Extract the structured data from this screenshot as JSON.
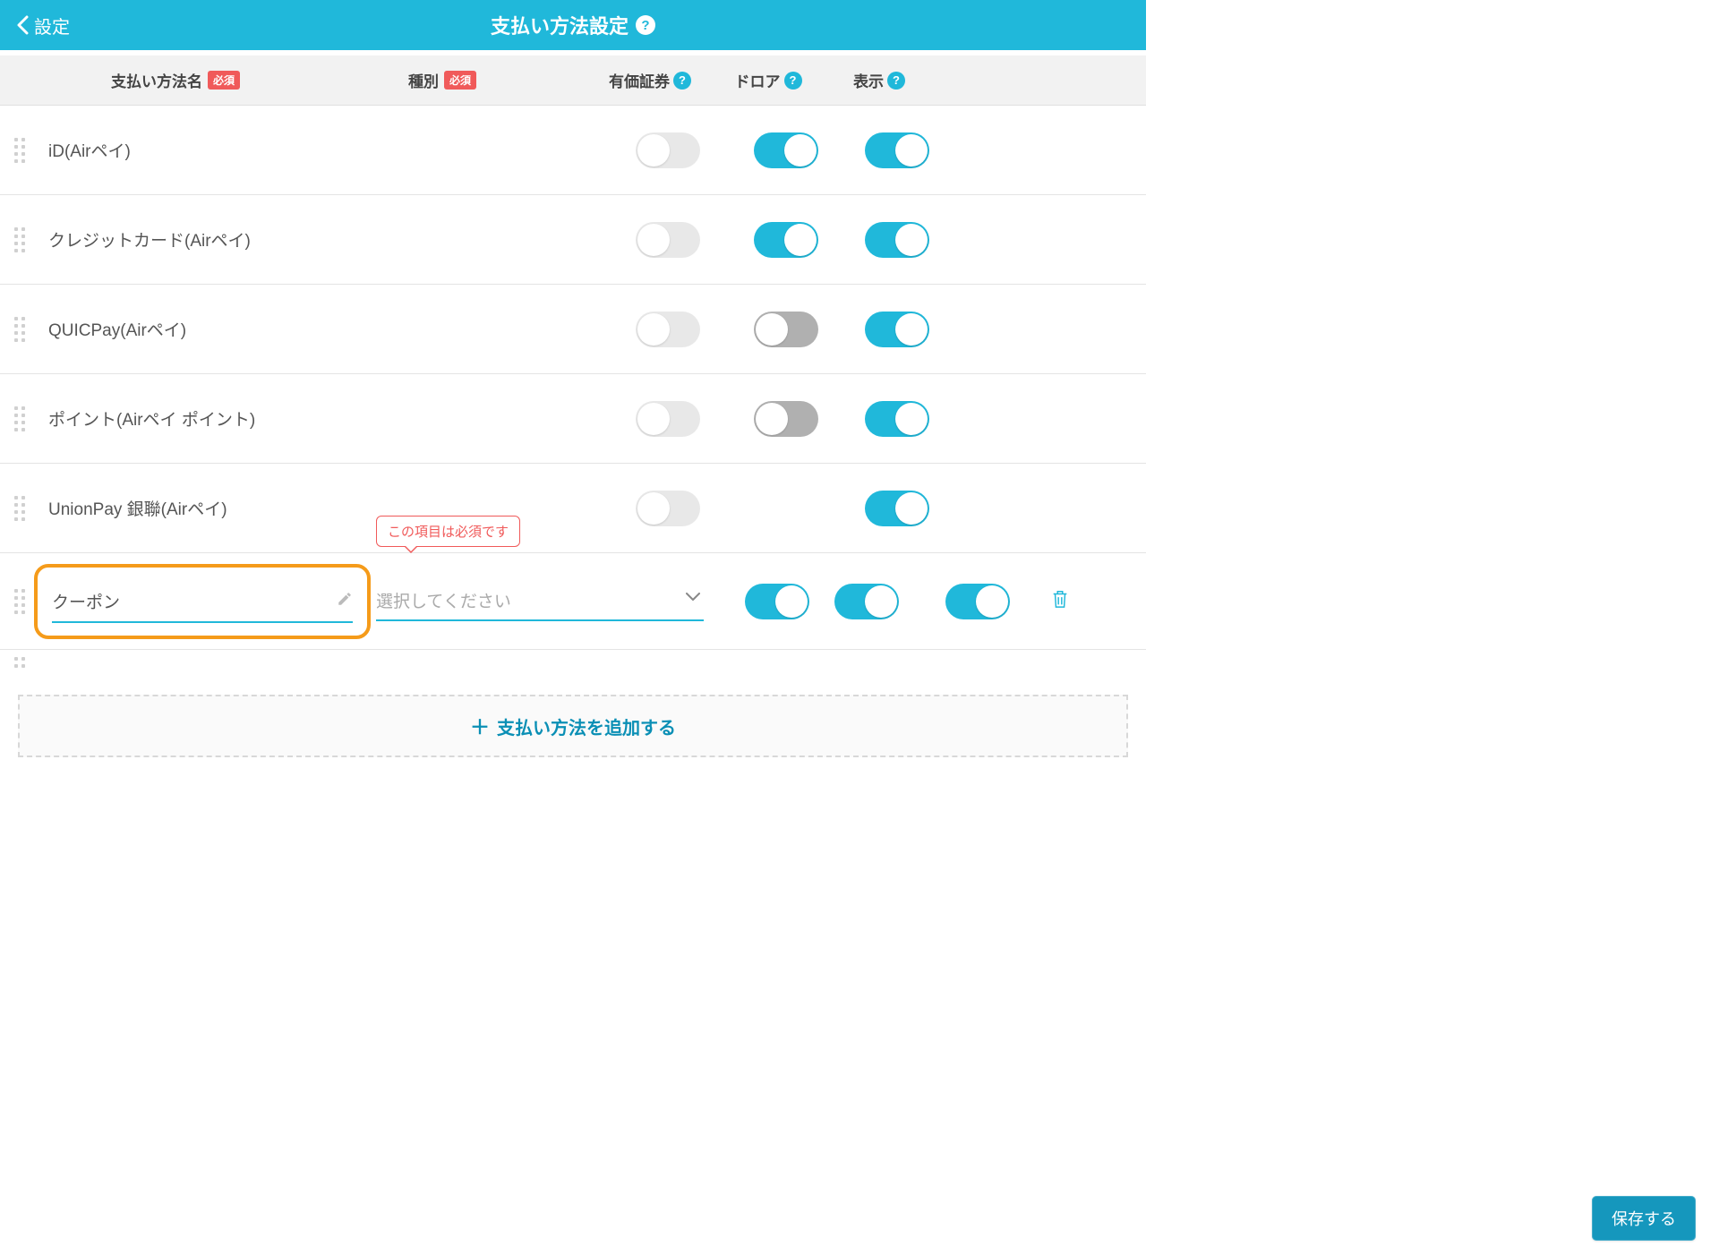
{
  "header": {
    "back_label": "設定",
    "title": "支払い方法設定"
  },
  "columns": {
    "name": "支払い方法名",
    "type": "種別",
    "securities": "有価証券",
    "drawer": "ドロア",
    "display": "表示",
    "required_badge": "必須"
  },
  "rows": [
    {
      "name": "iD(Airペイ)",
      "securities": "off-light",
      "drawer": "on",
      "display": "on"
    },
    {
      "name": "クレジットカード(Airペイ)",
      "securities": "off-light",
      "drawer": "on",
      "display": "on"
    },
    {
      "name": "QUICPay(Airペイ)",
      "securities": "off-light",
      "drawer": "off-gray",
      "display": "on"
    },
    {
      "name": "ポイント(Airペイ ポイント)",
      "securities": "off-light",
      "drawer": "off-gray",
      "display": "on"
    },
    {
      "name": "UnionPay 銀聯(Airペイ)",
      "securities": "off-light",
      "drawer": "none",
      "display": "on"
    }
  ],
  "edit_row": {
    "name_value": "クーポン",
    "type_placeholder": "選択してください",
    "error_text": "この項目は必須です",
    "securities": "on",
    "drawer": "on",
    "display": "on"
  },
  "add_label": "支払い方法を追加する",
  "save_label": "保存する"
}
